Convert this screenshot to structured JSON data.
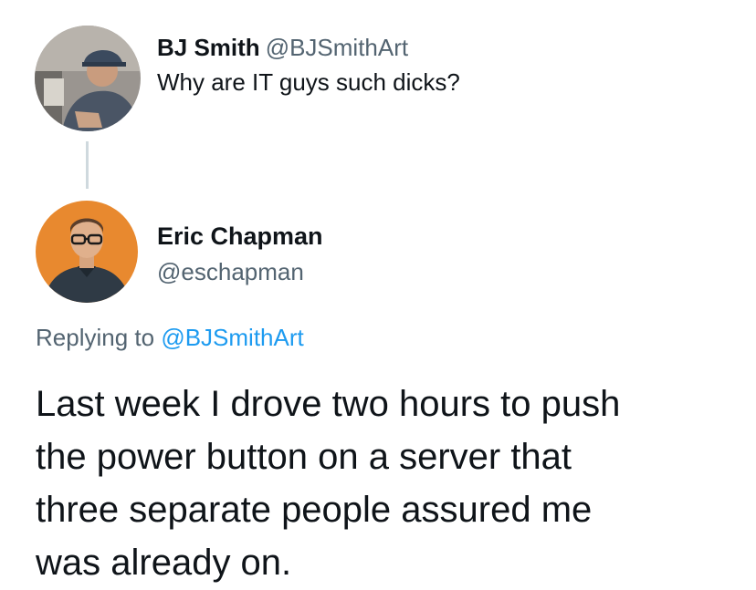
{
  "parent_tweet": {
    "author_name": "BJ Smith",
    "author_handle": "@BJSmithArt",
    "text": "Why are IT guys such dicks?",
    "avatar_icon": "profile-photo-bj-smith"
  },
  "reply": {
    "author_name": "Eric Chapman",
    "author_handle": "@eschapman",
    "avatar_icon": "profile-photo-eric-chapman",
    "replying_to_label": "Replying to",
    "replying_to_handle": "@BJSmithArt",
    "text_lines": [
      "Last week I drove two hours to push",
      "the power button on a server that",
      "three separate people assured me",
      "was already on."
    ]
  },
  "colors": {
    "primary_text": "#0f1419",
    "secondary_text": "#536471",
    "link": "#1d9bf0",
    "thread_line": "#cfd9de",
    "reply_avatar_bg": "#e8892f"
  }
}
